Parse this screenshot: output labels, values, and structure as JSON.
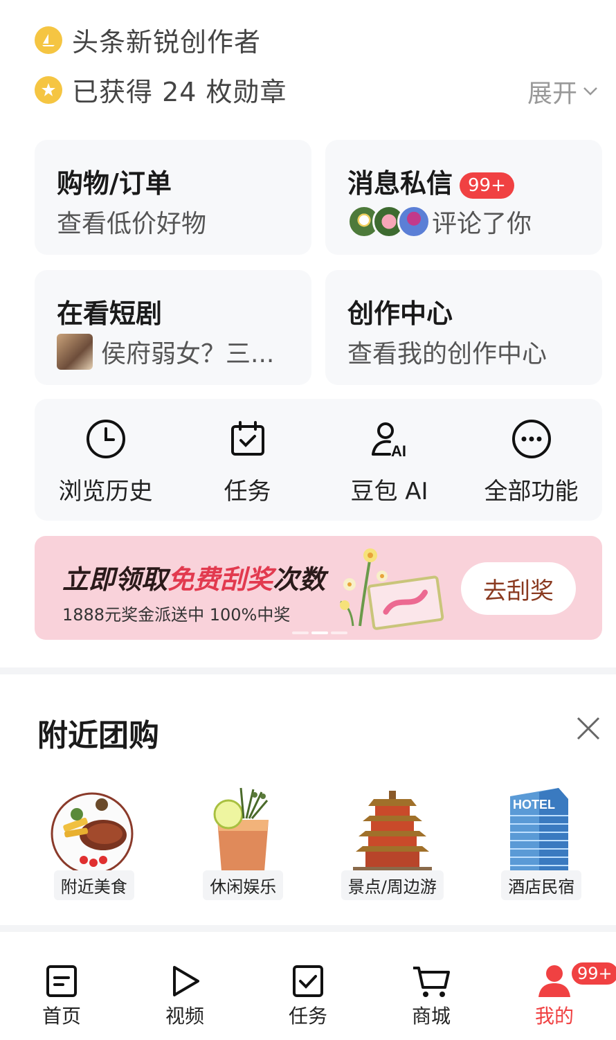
{
  "profile": {
    "title_badge": "头条新锐创作者",
    "medals_text": "已获得 24 枚勋章",
    "expand_label": "展开"
  },
  "cards": {
    "shopping": {
      "title": "购物/订单",
      "subtitle": "查看低价好物"
    },
    "messages": {
      "title": "消息私信",
      "badge": "99+",
      "subtitle": "评论了你"
    },
    "drama": {
      "title": "在看短剧",
      "subtitle": "侯府弱女？三..."
    },
    "creator": {
      "title": "创作中心",
      "subtitle": "查看我的创作中心"
    }
  },
  "quick_actions": [
    {
      "label": "浏览历史",
      "icon": "clock-icon"
    },
    {
      "label": "任务",
      "icon": "calendar-check-icon"
    },
    {
      "label": "豆包 AI",
      "icon": "ai-person-icon"
    },
    {
      "label": "全部功能",
      "icon": "more-dots-icon"
    }
  ],
  "promo": {
    "title_part1": "立即领取",
    "title_highlight": "免费刮奖",
    "title_part2": "次数",
    "subtitle": "1888元奖金派送中 100%中奖",
    "button": "去刮奖"
  },
  "nearby": {
    "title": "附近团购",
    "categories": [
      {
        "label": "附近美食",
        "icon": "steak-plate-image"
      },
      {
        "label": "休闲娱乐",
        "icon": "cocktail-image"
      },
      {
        "label": "景点/周边游",
        "icon": "pagoda-image"
      },
      {
        "label": "酒店民宿",
        "icon": "hotel-building-image"
      }
    ]
  },
  "tabbar": {
    "items": [
      {
        "label": "首页",
        "icon": "home-doc-icon"
      },
      {
        "label": "视频",
        "icon": "play-icon"
      },
      {
        "label": "任务",
        "icon": "task-check-icon"
      },
      {
        "label": "商城",
        "icon": "cart-icon"
      },
      {
        "label": "我的",
        "icon": "user-icon",
        "badge": "99+",
        "active": true
      }
    ]
  },
  "colors": {
    "accent_red": "#f04142",
    "gold": "#f5c542",
    "card_bg": "#f7f8fa",
    "promo_bg": "#f9d2da"
  }
}
